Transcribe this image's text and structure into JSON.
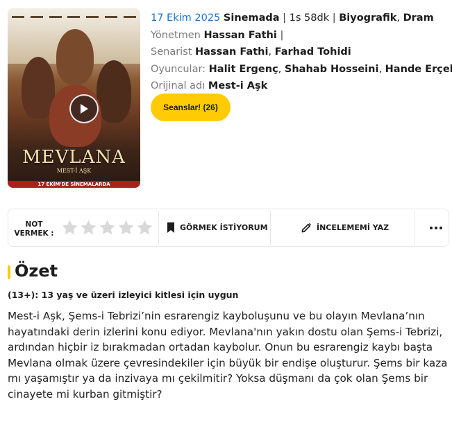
{
  "poster": {
    "title": "MEVLANA",
    "subtitle": "MEST-İ AŞK",
    "banner": "17 EKİM'DE SİNEMALARDA"
  },
  "movie": {
    "date": "17 Ekim 2025",
    "venue": "Sinemada",
    "duration": "1s 58dk",
    "genre1": "Biyografik",
    "genre2": "Dram",
    "director_label": "Yönetmen",
    "director": "Hassan Fathi",
    "writer_label": "Senarist",
    "writer1": "Hassan Fathi",
    "writer2": "Farhad Tohidi",
    "cast_label": "Oyuncular:",
    "cast1": "Halit Ergenç",
    "cast2": "Shahab Hosseini",
    "cast3": "Hande Erçel",
    "original_label": "Orijinal adı",
    "original_title": "Mest-i Aşk",
    "seans_button": "Seanslar! (26)"
  },
  "actions": {
    "rate_label_line1": "NOT",
    "rate_label_line2": "VERMEK :",
    "rating_value": 0,
    "rating_max": 5,
    "watchlist": "GÖRMEK İSTİYORUM",
    "review": "İNCELEMEMİ YAZ"
  },
  "summary": {
    "heading": "Özet",
    "age_rating": "(13+): 13 yaş ve üzeri izleyici kitlesi için uygun",
    "text": "Mest-i Aşk, Şems-i Tebrizi’nin esrarengiz kayboluşunu ve bu olayın Mevlana’nın hayatındaki derin izlerini konu ediyor. Mevlana'nın yakın dostu olan Şems-i Tebrizi, ardından hiçbir iz bırakmadan ortadan kaybolur. Onun bu esrarengiz kaybı başta Mevlana olmak üzere çevresindekiler için büyük bir endişe oluşturur. Şems bir kaza mı yaşamıştır ya da inzivaya mı çekilmitir? Yoksa düşmanı da çok olan Şems bir cinayete mi kurban gitmiştir?"
  },
  "colors": {
    "accent": "#ffcb05",
    "link_blue": "#1a73c8",
    "star_empty": "#d9d9d9"
  }
}
